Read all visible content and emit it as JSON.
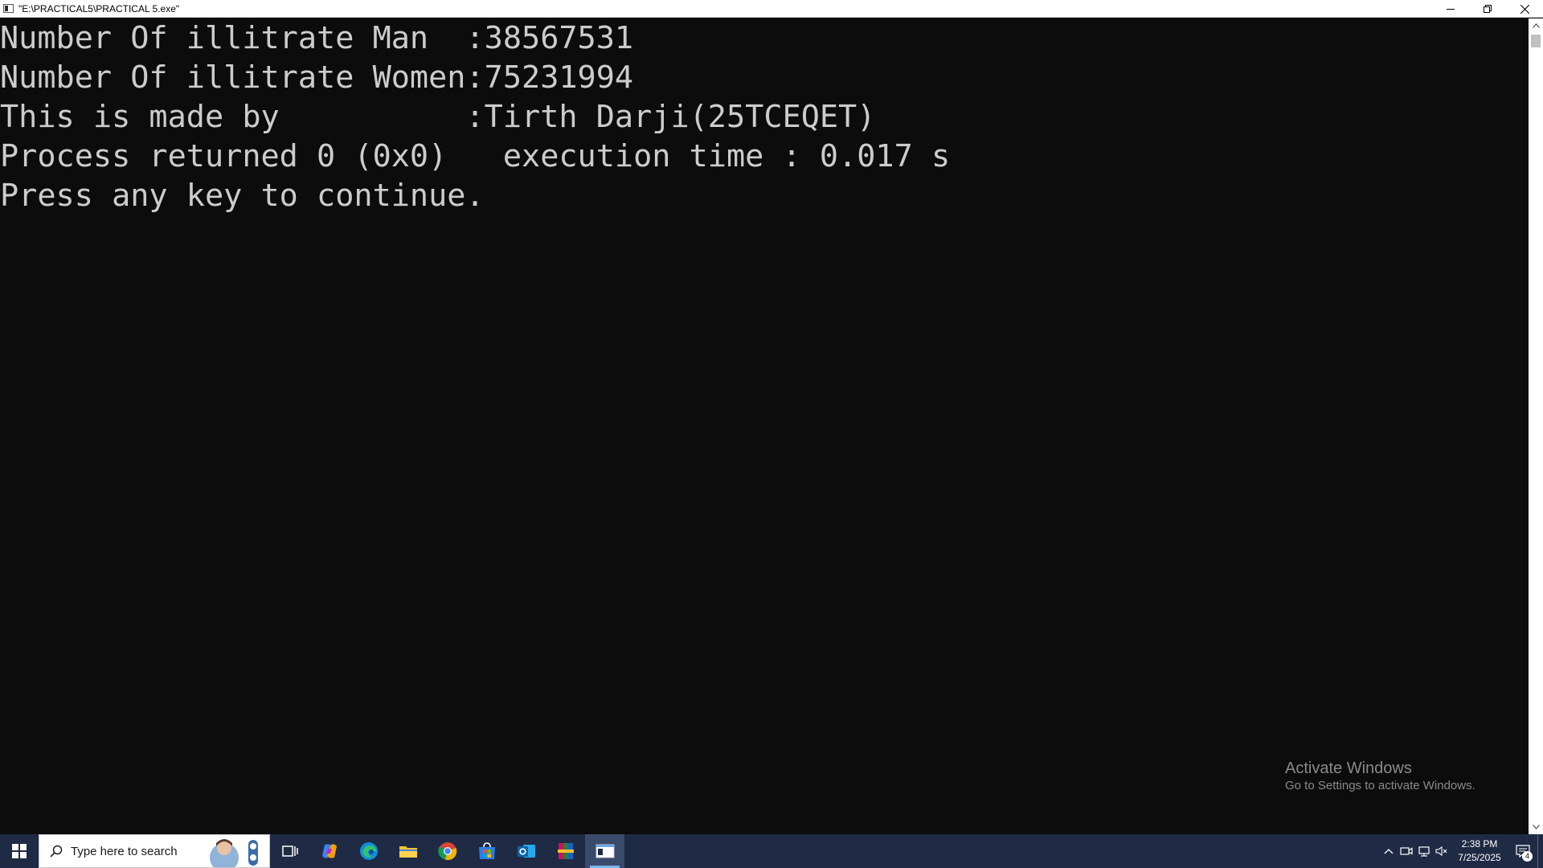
{
  "window": {
    "title": "\"E:\\PRACTICAL5\\PRACTICAL 5.exe\""
  },
  "console": {
    "lines": [
      "Number Of illitrate Man  :38567531",
      "Number Of illitrate Women:75231994",
      "This is made by          :Tirth Darji(25TCEQET)",
      "Process returned 0 (0x0)   execution time : 0.017 s",
      "Press any key to continue."
    ]
  },
  "watermark": {
    "title": "Activate Windows",
    "subtitle": "Go to Settings to activate Windows."
  },
  "taskbar": {
    "search_placeholder": "Type here to search",
    "apps": [
      "task-view",
      "copilot",
      "edge",
      "file-explorer",
      "chrome",
      "microsoft-store",
      "outlook",
      "winrar",
      "console-window"
    ],
    "time": "2:38 PM",
    "date": "7/25/2025",
    "notification_count": "4"
  },
  "colors": {
    "console_bg": "#0c0c0c",
    "console_text": "#cccccc",
    "taskbar_bg": "#1f2a44",
    "active_underline": "#76b9ed"
  }
}
